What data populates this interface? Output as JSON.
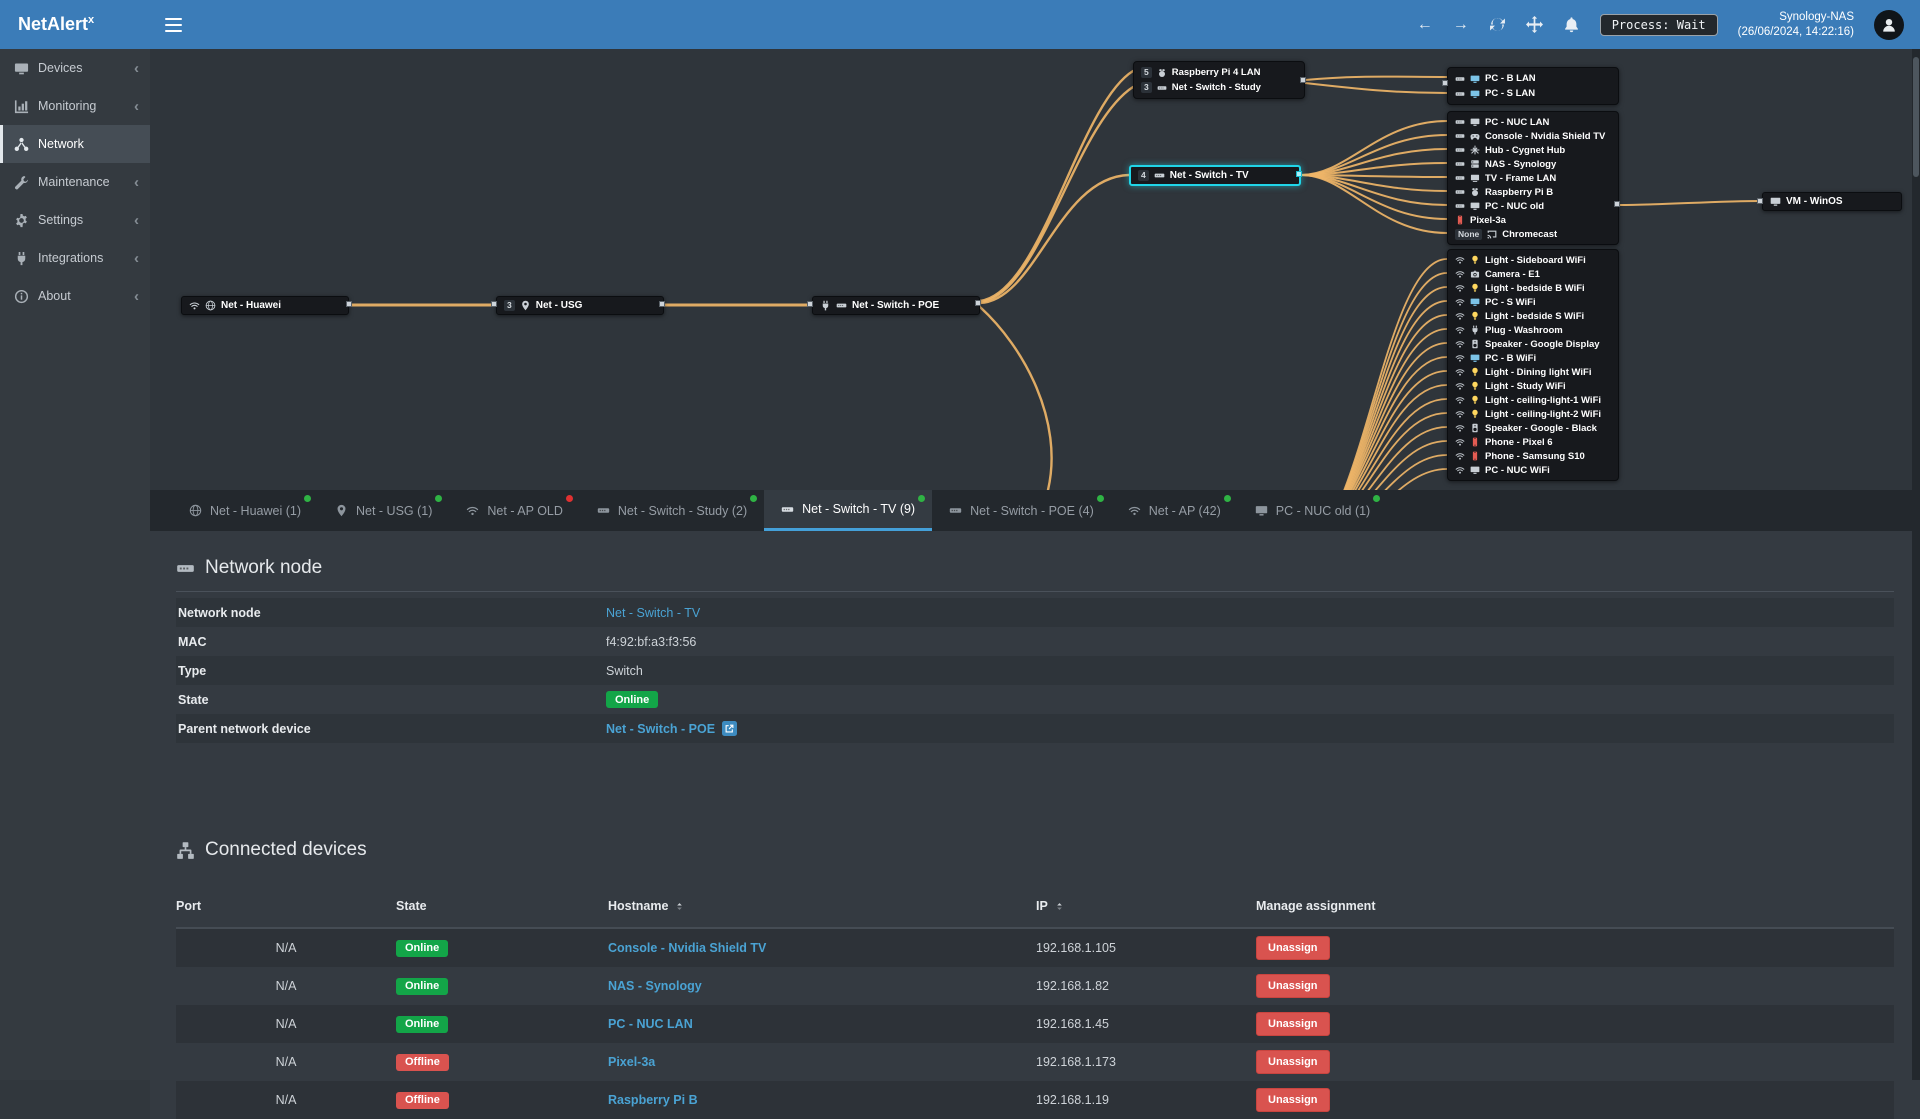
{
  "brand": {
    "name": "NetAlert",
    "sup": "x"
  },
  "topbar": {
    "process": "Process: Wait",
    "host": "Synology-NAS",
    "time": "(26/06/2024, 14:22:16)"
  },
  "colors": {
    "accent": "#3b7cb8",
    "topology_line": "#efb568",
    "online": "#13a548",
    "offline": "#d9534f",
    "link": "#4aa3d4",
    "selected_node": "#20d5e8"
  },
  "sidebar": {
    "items": [
      {
        "label": "Devices"
      },
      {
        "label": "Monitoring"
      },
      {
        "label": "Network"
      },
      {
        "label": "Maintenance"
      },
      {
        "label": "Settings"
      },
      {
        "label": "Integrations"
      },
      {
        "label": "About"
      }
    ]
  },
  "topology": {
    "huawei": {
      "label": "Net - Huawei"
    },
    "usg": {
      "port": "3",
      "label": "Net - USG"
    },
    "poe": {
      "label": "Net - Switch - POE"
    },
    "tv": {
      "port": "4",
      "label": "Net - Switch - TV"
    },
    "study": {
      "items": [
        {
          "port": "5",
          "label": "Raspberry Pi 4 LAN"
        },
        {
          "port": "3",
          "label": "Net - Switch - Study"
        }
      ]
    },
    "lan": {
      "items": [
        {
          "label": "PC - B LAN"
        },
        {
          "label": "PC - S LAN"
        }
      ]
    },
    "tv_children": {
      "items": [
        {
          "label": "PC - NUC LAN"
        },
        {
          "label": "Console - Nvidia Shield TV"
        },
        {
          "label": "Hub - Cygnet Hub"
        },
        {
          "label": "NAS - Synology"
        },
        {
          "label": "TV - Frame LAN"
        },
        {
          "label": "Raspberry Pi B"
        },
        {
          "label": "PC - NUC old"
        },
        {
          "label": "Pixel-3a"
        },
        {
          "port": "None",
          "label": "Chromecast"
        }
      ]
    },
    "vm": {
      "label": "VM - WinOS"
    },
    "wifi": {
      "items": [
        {
          "label": "Light - Sideboard WiFi"
        },
        {
          "label": "Camera - E1"
        },
        {
          "label": "Light - bedside B WiFi"
        },
        {
          "label": "PC - S WiFi"
        },
        {
          "label": "Light - bedside S WiFi"
        },
        {
          "label": "Plug - Washroom"
        },
        {
          "label": "Speaker - Google Display"
        },
        {
          "label": "PC - B WiFi"
        },
        {
          "label": "Light - Dining light WiFi"
        },
        {
          "label": "Light - Study WiFi"
        },
        {
          "label": "Light - ceiling-light-1 WiFi"
        },
        {
          "label": "Light - ceiling-light-2 WiFi"
        },
        {
          "label": "Speaker - Google - Black"
        },
        {
          "label": "Phone - Pixel 6"
        },
        {
          "label": "Phone - Samsung S10"
        },
        {
          "label": "PC - NUC WiFi"
        }
      ]
    }
  },
  "tabs": [
    {
      "label": "Net - Huawei (1)",
      "status": "green"
    },
    {
      "label": "Net - USG (1)",
      "status": "green"
    },
    {
      "label": "Net - AP OLD",
      "status": "red"
    },
    {
      "label": "Net - Switch - Study (2)",
      "status": "green"
    },
    {
      "label": "Net - Switch - TV (9)",
      "status": "green",
      "active": true
    },
    {
      "label": "Net - Switch - POE (4)",
      "status": "green"
    },
    {
      "label": "Net - AP (42)",
      "status": "green"
    },
    {
      "label": "PC - NUC old (1)",
      "status": "green"
    }
  ],
  "network_node": {
    "title": "Network node",
    "labels": {
      "node": "Network node",
      "mac": "MAC",
      "type": "Type",
      "state": "State",
      "parent": "Parent network device"
    },
    "values": {
      "node": "Net - Switch - TV",
      "mac": "f4:92:bf:a3:f3:56",
      "type": "Switch",
      "state": "Online",
      "parent": "Net - Switch - POE"
    }
  },
  "connected": {
    "title": "Connected devices",
    "columns": {
      "port": "Port",
      "state": "State",
      "hostname": "Hostname",
      "ip": "IP",
      "manage": "Manage assignment"
    },
    "unassign": "Unassign",
    "rows": [
      {
        "port": "N/A",
        "state": "Online",
        "hostname": "Console - Nvidia Shield TV",
        "ip": "192.168.1.105"
      },
      {
        "port": "N/A",
        "state": "Online",
        "hostname": "NAS - Synology",
        "ip": "192.168.1.82"
      },
      {
        "port": "N/A",
        "state": "Online",
        "hostname": "PC - NUC LAN",
        "ip": "192.168.1.45"
      },
      {
        "port": "N/A",
        "state": "Offline",
        "hostname": "Pixel-3a",
        "ip": "192.168.1.173"
      },
      {
        "port": "N/A",
        "state": "Offline",
        "hostname": "Raspberry Pi B",
        "ip": "192.168.1.19"
      }
    ]
  }
}
